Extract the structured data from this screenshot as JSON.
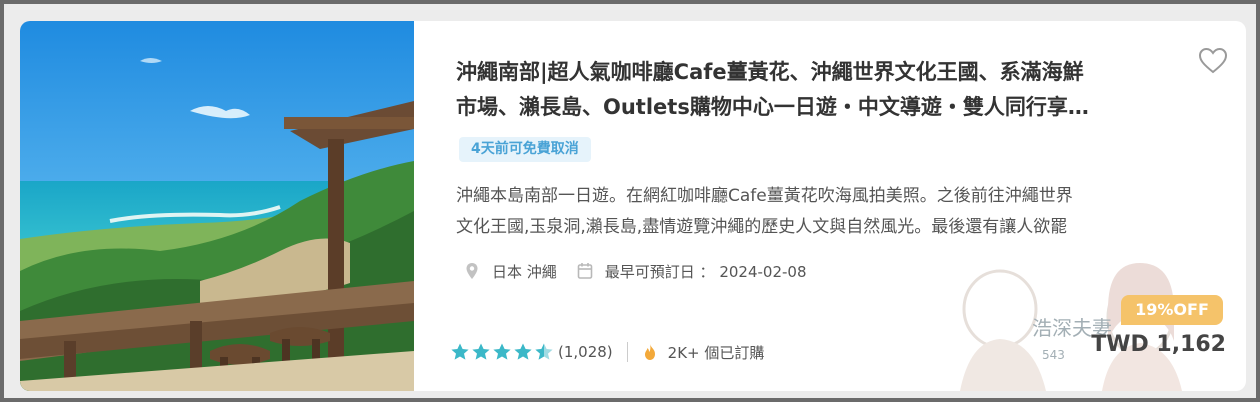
{
  "card": {
    "title_line1": "沖繩南部|超人氣咖啡廳Cafe薑黃花、沖繩世界文化王國、系滿海鮮",
    "title_line2": "市場、瀨長島、Outlets購物中心一日遊・中文導遊・雙人同行享…",
    "badge": "4天前可免費取消",
    "desc_line1": "沖繩本島南部一日遊。在網紅咖啡廳Cafe薑黃花吹海風拍美照。之後前往沖繩世界",
    "desc_line2": "文化王國,玉泉洞,瀨長島,盡情遊覽沖繩的歷史人文與自然風光。最後還有讓人欲罷",
    "location": "日本 沖繩",
    "date_label": "最早可預訂日 ： 2024-02-08",
    "rating_count": "(1,028)",
    "booked": "2K+ 個已訂購",
    "discount": "19%OFF",
    "price": "TWD 1,162",
    "watermark_text": "浩深夫妻",
    "watermark_sub": "543"
  },
  "icons": {
    "location": "location-pin-icon",
    "calendar": "calendar-icon",
    "fire": "fire-icon",
    "heart": "heart-outline-icon",
    "star": "star-icon"
  },
  "colors": {
    "star": "#3bb8c8",
    "badge_bg": "#e6f3fb",
    "badge_text": "#4aa3d6",
    "discount_bg": "#f5c36a",
    "fire": "#f3a93a"
  },
  "rating_stars": 4.5
}
